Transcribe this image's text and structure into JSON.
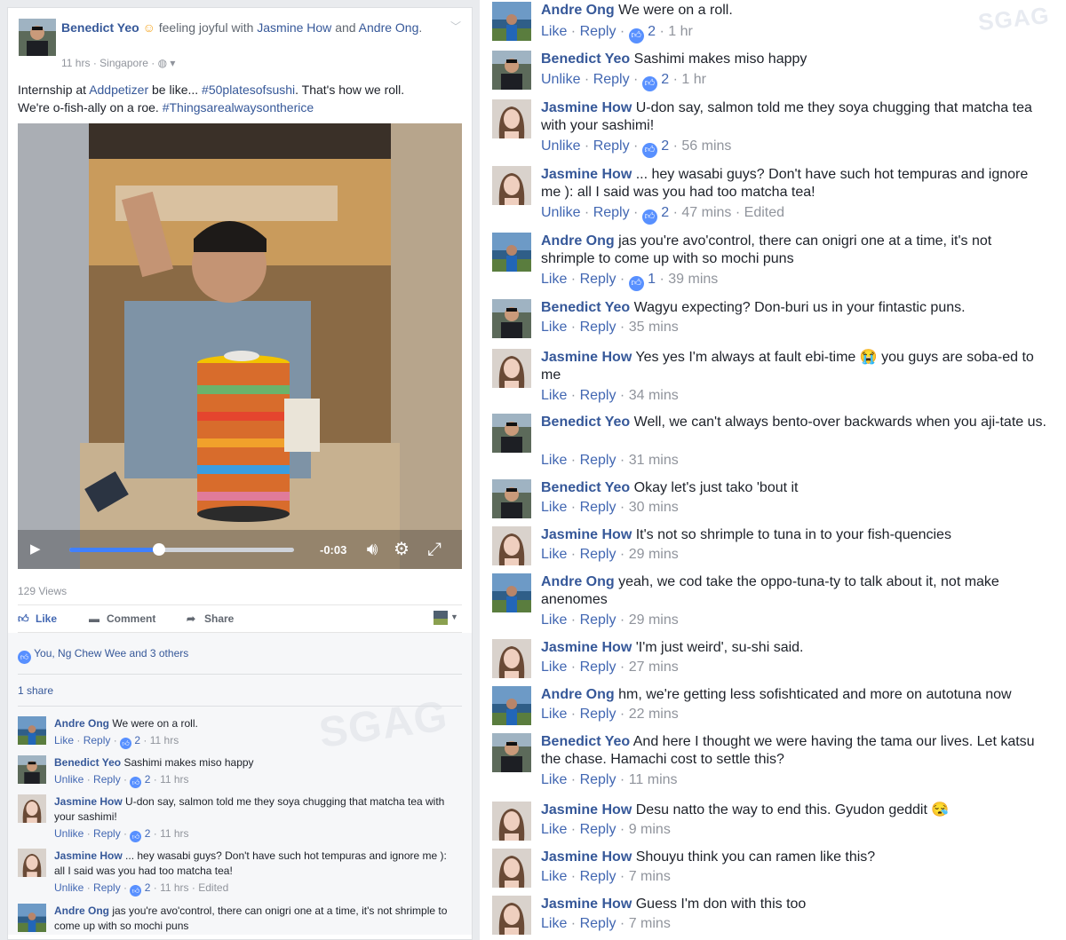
{
  "post": {
    "author": "Benedict Yeo",
    "feeling_emoji": "☺",
    "feeling": "feeling joyful with",
    "tagged1": "Jasmine How",
    "and": "and",
    "tagged2": "Andre Ong",
    "period": ".",
    "time": "11 hrs",
    "location": "Singapore",
    "privacy_icon": "globe-icon",
    "text_prefix": "Internship at",
    "page_link": "Addpetizer",
    "text_mid": "be like...",
    "hashtag1": "#50platesofsushi",
    "text_mid2": ". That's how we roll.",
    "text_line2": "We're o-fish-ally on a roe.",
    "hashtag2": "#Thingsarealwaysontherice",
    "video": {
      "time_remaining": "-0:03",
      "progress": 0.4
    },
    "views": "129 Views",
    "actions": {
      "like": "Like",
      "comment": "Comment",
      "share": "Share"
    },
    "reactions": "You, Ng Chew Wee and 3 others",
    "shares": "1 share"
  },
  "left_comments": [
    {
      "name": "Andre Ong",
      "text": "We were on a roll.",
      "a1": "Like",
      "count": "2",
      "time": "11 hrs",
      "edited": ""
    },
    {
      "name": "Benedict Yeo",
      "text": "Sashimi makes miso happy",
      "a1": "Unlike",
      "count": "2",
      "time": "11 hrs",
      "edited": ""
    },
    {
      "name": "Jasmine How",
      "text": "U-don say, salmon told me they soya chugging that matcha tea with your sashimi!",
      "a1": "Unlike",
      "count": "2",
      "time": "11 hrs",
      "edited": ""
    },
    {
      "name": "Jasmine How",
      "text": "... hey wasabi guys? Don't have such hot tempuras and ignore me ): all I said was you had too matcha tea!",
      "a1": "Unlike",
      "count": "2",
      "time": "11 hrs",
      "edited": "Edited"
    },
    {
      "name": "Andre Ong",
      "text": "jas you're avo'control, there can onigri one at a time, it's not shrimple to come up with so mochi puns",
      "a1": "",
      "count": "",
      "time": "",
      "edited": ""
    }
  ],
  "right_comments": [
    {
      "name": "Andre Ong",
      "text": "We were on a roll.",
      "a1": "Like",
      "count": "2",
      "time": "1 hr",
      "edited": ""
    },
    {
      "name": "Benedict Yeo",
      "text": "Sashimi makes miso happy",
      "a1": "Unlike",
      "count": "2",
      "time": "1 hr",
      "edited": ""
    },
    {
      "name": "Jasmine How",
      "text": "U-don say, salmon told me they soya chugging that matcha tea with your sashimi!",
      "a1": "Unlike",
      "count": "2",
      "time": "56 mins",
      "edited": ""
    },
    {
      "name": "Jasmine How",
      "text": "... hey wasabi guys? Don't have such hot tempuras and ignore me ): all I said was you had too matcha tea!",
      "a1": "Unlike",
      "count": "2",
      "time": "47 mins",
      "edited": "Edited"
    },
    {
      "name": "Andre Ong",
      "text": "jas you're avo'control, there can onigri one at a time, it's not shrimple to come up with so mochi puns",
      "a1": "Like",
      "count": "1",
      "time": "39 mins",
      "edited": ""
    },
    {
      "name": "Benedict Yeo",
      "text": "Wagyu expecting? Don-buri us in your fintastic puns.",
      "a1": "Like",
      "count": "",
      "time": "35 mins",
      "edited": ""
    },
    {
      "name": "Jasmine How",
      "text": "Yes yes I'm always at fault ebi-time 😭 you guys are soba-ed to me",
      "a1": "Like",
      "count": "",
      "time": "34 mins",
      "edited": ""
    },
    {
      "name": "Benedict Yeo",
      "text": "Well, we can't always bento-over backwards when you aji-tate us.",
      "a1": "Like",
      "count": "",
      "time": "31 mins",
      "edited": ""
    },
    {
      "name": "Benedict Yeo",
      "text": "Okay let's just tako 'bout it",
      "a1": "Like",
      "count": "",
      "time": "30 mins",
      "edited": ""
    },
    {
      "name": "Jasmine How",
      "text": "It's not so shrimple to tuna in to your fish-quencies",
      "a1": "Like",
      "count": "",
      "time": "29 mins",
      "edited": ""
    },
    {
      "name": "Andre Ong",
      "text": "yeah, we cod take the oppo-tuna-ty to talk about it, not make anenomes",
      "a1": "Like",
      "count": "",
      "time": "29 mins",
      "edited": ""
    },
    {
      "name": "Jasmine How",
      "text": "'I'm just weird', su-shi said.",
      "a1": "Like",
      "count": "",
      "time": "27 mins",
      "edited": ""
    },
    {
      "name": "Andre Ong",
      "text": "hm, we're getting less sofishticated and more on autotuna now",
      "a1": "Like",
      "count": "",
      "time": "22 mins",
      "edited": ""
    },
    {
      "name": "Benedict Yeo",
      "text": "And here I thought we were having the tama our lives. Let katsu the chase. Hamachi cost to settle this?",
      "a1": "Like",
      "count": "",
      "time": "11 mins",
      "edited": ""
    },
    {
      "name": "Jasmine How",
      "text": "Desu natto the way to end this. Gyudon geddit 😪",
      "a1": "Like",
      "count": "",
      "time": "9 mins",
      "edited": ""
    },
    {
      "name": "Jasmine How",
      "text": "Shouyu think you can ramen like this?",
      "a1": "Like",
      "count": "",
      "time": "7 mins",
      "edited": ""
    },
    {
      "name": "Jasmine How",
      "text": "Guess I'm don with this too",
      "a1": "Like",
      "count": "",
      "time": "7 mins",
      "edited": ""
    }
  ],
  "common": {
    "reply": "Reply",
    "dot": " · ",
    "like_icon": "thumbs-up-icon"
  },
  "watermark": "SGAG",
  "colors": {
    "link": "#365899",
    "like_blue": "#5890ff",
    "meta": "#90949c"
  }
}
